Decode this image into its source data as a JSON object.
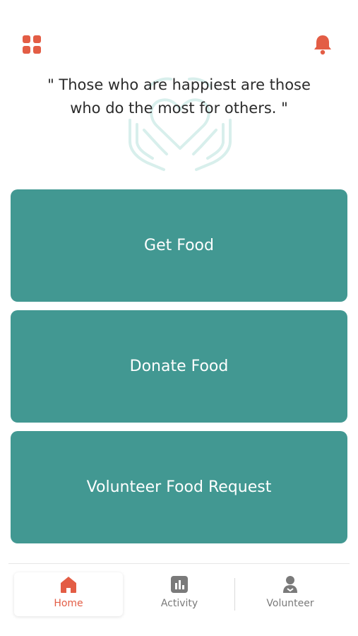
{
  "colors": {
    "accent": "#e35d45",
    "primary_button": "#429892",
    "nav_inactive": "#7a7a7a"
  },
  "header": {
    "menu_icon": "grid-icon",
    "notification_icon": "bell-icon"
  },
  "quote": {
    "line1": "\" Those who are happiest are those",
    "line2": "who do the most for others. \""
  },
  "actions": [
    {
      "label": "Get Food"
    },
    {
      "label": "Donate Food"
    },
    {
      "label": "Volunteer Food Request"
    }
  ],
  "nav": {
    "items": [
      {
        "label": "Home",
        "icon": "home-icon",
        "active": true
      },
      {
        "label": "Activity",
        "icon": "activity-icon",
        "active": false
      },
      {
        "label": "Volunteer",
        "icon": "volunteer-icon",
        "active": false
      }
    ]
  }
}
